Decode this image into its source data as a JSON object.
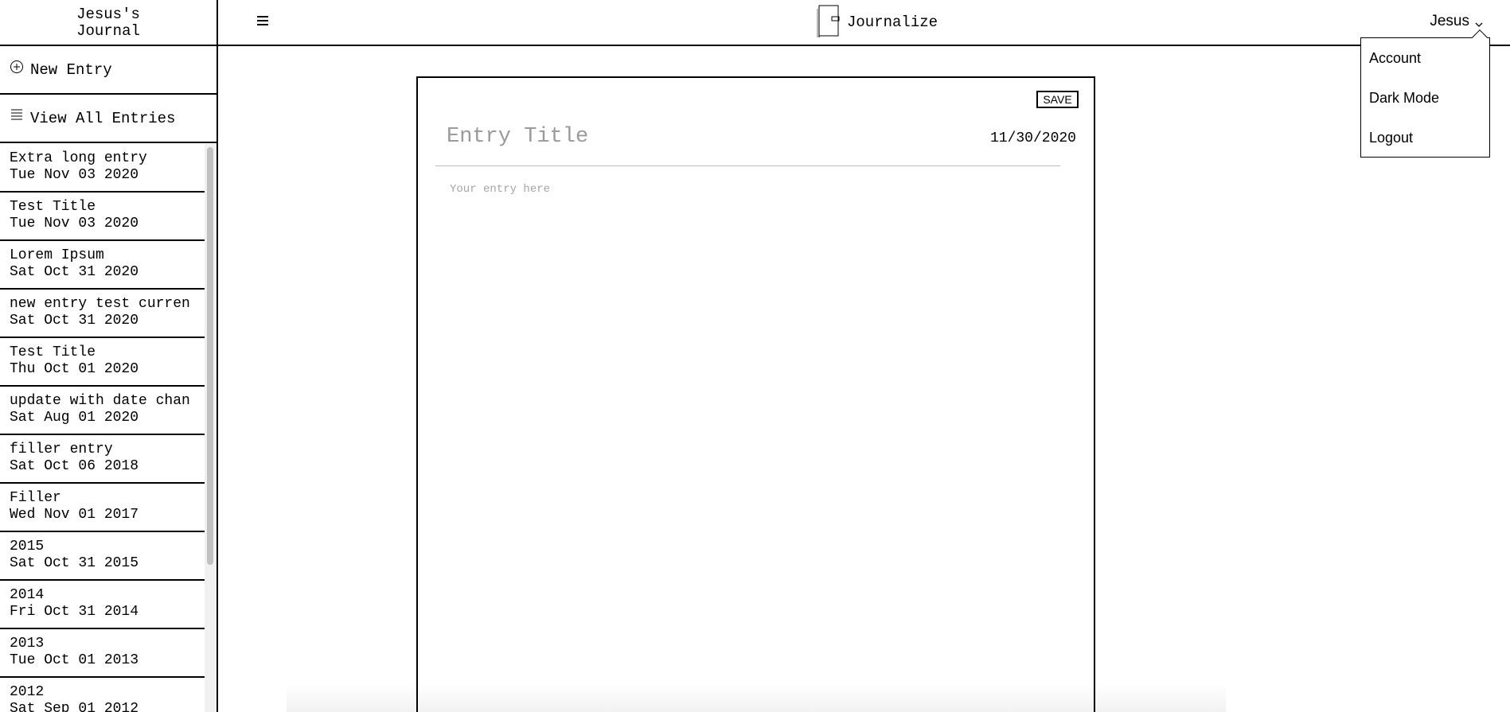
{
  "sidebar": {
    "journal_title_line1": "Jesus's",
    "journal_title_line2": "Journal",
    "new_entry_label": "New Entry",
    "view_all_label": "View All Entries",
    "entries": [
      {
        "title": "Extra long entry",
        "date": "Tue Nov 03 2020"
      },
      {
        "title": "Test Title",
        "date": "Tue Nov 03 2020"
      },
      {
        "title": "Lorem Ipsum",
        "date": "Sat Oct 31 2020"
      },
      {
        "title": "new entry test curren",
        "date": "Sat Oct 31 2020"
      },
      {
        "title": "Test Title",
        "date": "Thu Oct 01 2020"
      },
      {
        "title": "update with date chan",
        "date": "Sat Aug 01 2020"
      },
      {
        "title": "filler entry",
        "date": "Sat Oct 06 2018"
      },
      {
        "title": "Filler",
        "date": "Wed Nov 01 2017"
      },
      {
        "title": "2015",
        "date": "Sat Oct 31 2015"
      },
      {
        "title": "2014",
        "date": "Fri Oct 31 2014"
      },
      {
        "title": "2013",
        "date": "Tue Oct 01 2013"
      },
      {
        "title": "2012",
        "date": "Sat Sep 01 2012"
      }
    ]
  },
  "header": {
    "app_name": "Journalize",
    "user_name": "Jesus"
  },
  "user_dropdown": {
    "items": [
      "Account",
      "Dark Mode",
      "Logout"
    ]
  },
  "editor": {
    "save_label": "SAVE",
    "title_placeholder": "Entry Title",
    "date": "11/30/2020",
    "body_placeholder": "Your entry here"
  },
  "icons": {
    "new_entry": "plus-circle-icon",
    "view_all": "list-icon",
    "menu": "hamburger-icon",
    "logo": "journal-book-icon",
    "user_menu": "chevron-down-icon"
  }
}
